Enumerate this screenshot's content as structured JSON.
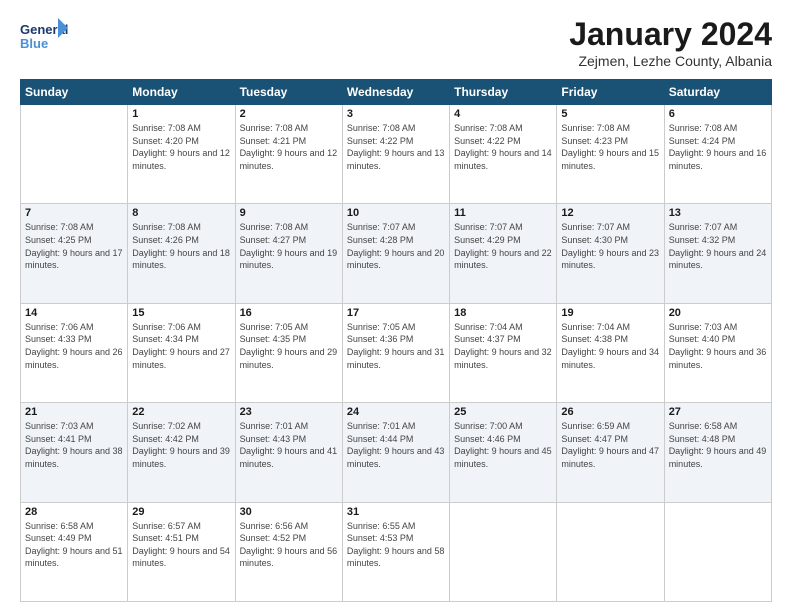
{
  "header": {
    "logo_line1": "General",
    "logo_line2": "Blue",
    "month": "January 2024",
    "location": "Zejmen, Lezhe County, Albania"
  },
  "days_of_week": [
    "Sunday",
    "Monday",
    "Tuesday",
    "Wednesday",
    "Thursday",
    "Friday",
    "Saturday"
  ],
  "weeks": [
    [
      {
        "day": "",
        "sunrise": "",
        "sunset": "",
        "daylight": ""
      },
      {
        "day": "1",
        "sunrise": "7:08 AM",
        "sunset": "4:20 PM",
        "daylight": "9 hours and 12 minutes."
      },
      {
        "day": "2",
        "sunrise": "7:08 AM",
        "sunset": "4:21 PM",
        "daylight": "9 hours and 12 minutes."
      },
      {
        "day": "3",
        "sunrise": "7:08 AM",
        "sunset": "4:22 PM",
        "daylight": "9 hours and 13 minutes."
      },
      {
        "day": "4",
        "sunrise": "7:08 AM",
        "sunset": "4:22 PM",
        "daylight": "9 hours and 14 minutes."
      },
      {
        "day": "5",
        "sunrise": "7:08 AM",
        "sunset": "4:23 PM",
        "daylight": "9 hours and 15 minutes."
      },
      {
        "day": "6",
        "sunrise": "7:08 AM",
        "sunset": "4:24 PM",
        "daylight": "9 hours and 16 minutes."
      }
    ],
    [
      {
        "day": "7",
        "sunrise": "7:08 AM",
        "sunset": "4:25 PM",
        "daylight": "9 hours and 17 minutes."
      },
      {
        "day": "8",
        "sunrise": "7:08 AM",
        "sunset": "4:26 PM",
        "daylight": "9 hours and 18 minutes."
      },
      {
        "day": "9",
        "sunrise": "7:08 AM",
        "sunset": "4:27 PM",
        "daylight": "9 hours and 19 minutes."
      },
      {
        "day": "10",
        "sunrise": "7:07 AM",
        "sunset": "4:28 PM",
        "daylight": "9 hours and 20 minutes."
      },
      {
        "day": "11",
        "sunrise": "7:07 AM",
        "sunset": "4:29 PM",
        "daylight": "9 hours and 22 minutes."
      },
      {
        "day": "12",
        "sunrise": "7:07 AM",
        "sunset": "4:30 PM",
        "daylight": "9 hours and 23 minutes."
      },
      {
        "day": "13",
        "sunrise": "7:07 AM",
        "sunset": "4:32 PM",
        "daylight": "9 hours and 24 minutes."
      }
    ],
    [
      {
        "day": "14",
        "sunrise": "7:06 AM",
        "sunset": "4:33 PM",
        "daylight": "9 hours and 26 minutes."
      },
      {
        "day": "15",
        "sunrise": "7:06 AM",
        "sunset": "4:34 PM",
        "daylight": "9 hours and 27 minutes."
      },
      {
        "day": "16",
        "sunrise": "7:05 AM",
        "sunset": "4:35 PM",
        "daylight": "9 hours and 29 minutes."
      },
      {
        "day": "17",
        "sunrise": "7:05 AM",
        "sunset": "4:36 PM",
        "daylight": "9 hours and 31 minutes."
      },
      {
        "day": "18",
        "sunrise": "7:04 AM",
        "sunset": "4:37 PM",
        "daylight": "9 hours and 32 minutes."
      },
      {
        "day": "19",
        "sunrise": "7:04 AM",
        "sunset": "4:38 PM",
        "daylight": "9 hours and 34 minutes."
      },
      {
        "day": "20",
        "sunrise": "7:03 AM",
        "sunset": "4:40 PM",
        "daylight": "9 hours and 36 minutes."
      }
    ],
    [
      {
        "day": "21",
        "sunrise": "7:03 AM",
        "sunset": "4:41 PM",
        "daylight": "9 hours and 38 minutes."
      },
      {
        "day": "22",
        "sunrise": "7:02 AM",
        "sunset": "4:42 PM",
        "daylight": "9 hours and 39 minutes."
      },
      {
        "day": "23",
        "sunrise": "7:01 AM",
        "sunset": "4:43 PM",
        "daylight": "9 hours and 41 minutes."
      },
      {
        "day": "24",
        "sunrise": "7:01 AM",
        "sunset": "4:44 PM",
        "daylight": "9 hours and 43 minutes."
      },
      {
        "day": "25",
        "sunrise": "7:00 AM",
        "sunset": "4:46 PM",
        "daylight": "9 hours and 45 minutes."
      },
      {
        "day": "26",
        "sunrise": "6:59 AM",
        "sunset": "4:47 PM",
        "daylight": "9 hours and 47 minutes."
      },
      {
        "day": "27",
        "sunrise": "6:58 AM",
        "sunset": "4:48 PM",
        "daylight": "9 hours and 49 minutes."
      }
    ],
    [
      {
        "day": "28",
        "sunrise": "6:58 AM",
        "sunset": "4:49 PM",
        "daylight": "9 hours and 51 minutes."
      },
      {
        "day": "29",
        "sunrise": "6:57 AM",
        "sunset": "4:51 PM",
        "daylight": "9 hours and 54 minutes."
      },
      {
        "day": "30",
        "sunrise": "6:56 AM",
        "sunset": "4:52 PM",
        "daylight": "9 hours and 56 minutes."
      },
      {
        "day": "31",
        "sunrise": "6:55 AM",
        "sunset": "4:53 PM",
        "daylight": "9 hours and 58 minutes."
      },
      {
        "day": "",
        "sunrise": "",
        "sunset": "",
        "daylight": ""
      },
      {
        "day": "",
        "sunrise": "",
        "sunset": "",
        "daylight": ""
      },
      {
        "day": "",
        "sunrise": "",
        "sunset": "",
        "daylight": ""
      }
    ]
  ]
}
